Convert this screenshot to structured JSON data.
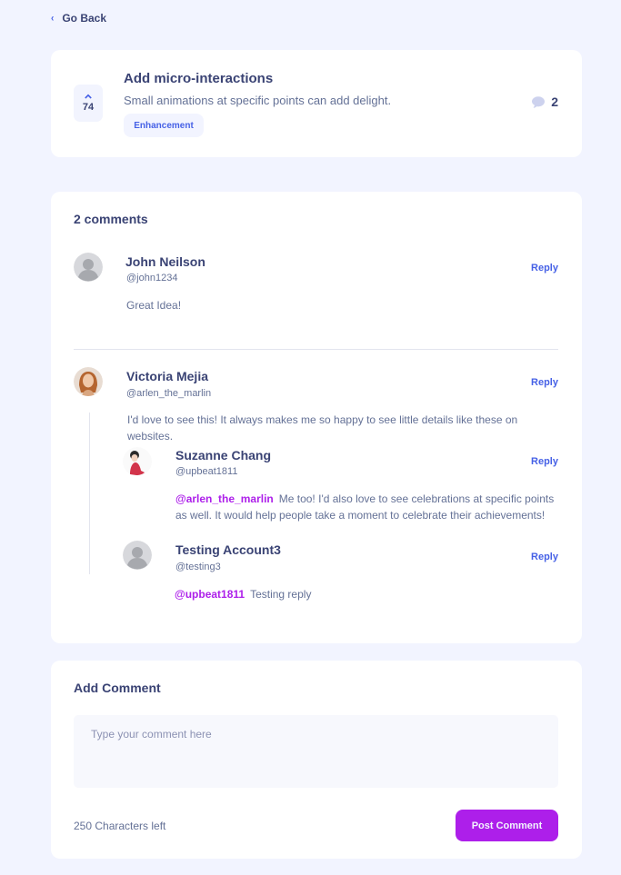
{
  "nav": {
    "go_back_label": "Go Back"
  },
  "feedback": {
    "title": "Add micro-interactions",
    "description": "Small animations at specific points can add delight.",
    "category": "Enhancement",
    "upvotes": "74",
    "comment_count": "2"
  },
  "comments_section": {
    "heading": "2 comments",
    "reply_label": "Reply",
    "items": [
      {
        "name": "John Neilson",
        "handle": "@john1234",
        "content": "Great Idea!"
      },
      {
        "name": "Victoria Mejia",
        "handle": "@arlen_the_marlin",
        "content": "I'd love to see this! It always makes me so happy to see little details like these on websites."
      }
    ],
    "replies": [
      {
        "name": "Suzanne Chang",
        "handle": "@upbeat1811",
        "replying_to": "@arlen_the_marlin",
        "content": "Me too! I'd also love to see celebrations at specific points as well. It would help people take a moment to celebrate their achievements!"
      },
      {
        "name": "Testing Account3",
        "handle": "@testing3",
        "replying_to": "@upbeat1811",
        "content": "Testing reply"
      }
    ]
  },
  "add_comment": {
    "title": "Add Comment",
    "placeholder": "Type your comment here",
    "chars_left": "250 Characters left",
    "post_label": "Post Comment"
  },
  "colors": {
    "background": "#f2f4ff",
    "primary_text": "#3a4374",
    "secondary_text": "#647196",
    "accent_blue": "#4661e6",
    "accent_purple": "#ad1fea"
  },
  "icons": {
    "back": "chevron-left-icon",
    "upvote": "chevron-up-icon",
    "comments": "comment-bubble-icon"
  }
}
